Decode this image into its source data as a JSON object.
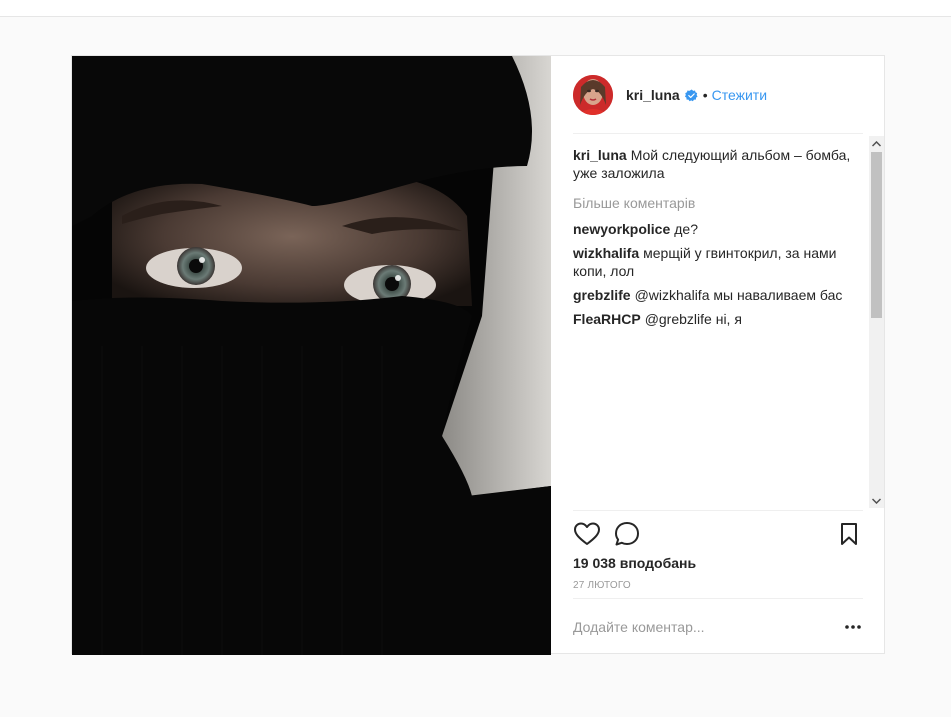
{
  "post": {
    "username": "kri_luna",
    "follow_label": "Стежити",
    "dot": "•",
    "caption": {
      "username": "kri_luna",
      "text": "Мой следующий альбом – бомба, уже заложила"
    },
    "more_comments_label": "Більше коментарів",
    "comments": [
      {
        "username": "newyorkpolice",
        "text": "де?"
      },
      {
        "username": "wizkhalifa",
        "text": "мерщій у гвинтокрил, за нами копи, лол"
      },
      {
        "username": "grebzlife",
        "text": "@wizkhalifa мы наваливаем бас"
      },
      {
        "username": "FleaRHCP",
        "text": "@grebzlife ні, я"
      }
    ],
    "likes": "19 038 вподобань",
    "date": "27 ЛЮТОГО",
    "comment_placeholder": "Додайте коментар...",
    "icons": {
      "like": "heart-icon",
      "comment": "comment-bubble-icon",
      "save": "bookmark-icon",
      "options": "more-dots-icon",
      "verified": "verified-badge-icon"
    },
    "colors": {
      "link": "#3897f0",
      "muted": "#999999",
      "text": "#262626",
      "verified": "#3897f0"
    }
  }
}
